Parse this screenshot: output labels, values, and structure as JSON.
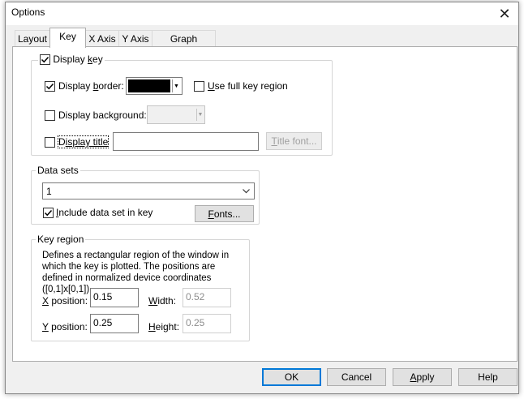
{
  "window": {
    "title": "Options"
  },
  "tabs": [
    {
      "label": "Layout",
      "active": false
    },
    {
      "label": "Key",
      "active": true
    },
    {
      "label": "X Axis",
      "active": false
    },
    {
      "label": "Y Axis",
      "active": false
    },
    {
      "label": "Graph Options",
      "active": false
    }
  ],
  "display_key": {
    "label_prefix": "Display ",
    "label_underline": "k",
    "label_suffix": "ey",
    "checked": true
  },
  "display_border": {
    "label_prefix": "Display ",
    "label_underline": "b",
    "label_suffix": "order:",
    "checked": true,
    "color": "#000000"
  },
  "use_full_key_region": {
    "label_underline": "U",
    "label_suffix": "se full key region",
    "checked": false
  },
  "display_background": {
    "label": "Display background:",
    "checked": false,
    "color": "#f0f0f0"
  },
  "display_title": {
    "label_prefix": "D",
    "label_underline": "isplay title",
    "label_suffix": "",
    "checked": false,
    "value": ""
  },
  "title_font_button": {
    "label_underline": "T",
    "label_suffix": "itle font..."
  },
  "data_sets": {
    "legend": "Data sets",
    "selected": "1",
    "include_label_prefix": "I",
    "include_label_suffix": "nclude data set in key",
    "include_checked": true,
    "fonts_underline": "F",
    "fonts_suffix": "onts..."
  },
  "key_region": {
    "legend": "Key region",
    "description": "Defines a rectangular region of the window in which the key is plotted. The positions are defined in normalized device coordinates ([0,1]x[0,1])",
    "x_label_underline": "X",
    "x_label_suffix": " position:",
    "x_value": "0.15",
    "y_label_underline": "Y",
    "y_label_suffix": " position:",
    "y_value": "0.25",
    "width_label_underline": "W",
    "width_label_suffix": "idth:",
    "width_value": "0.52",
    "height_label_underline": "H",
    "height_label_suffix": "eight:",
    "height_value": "0.25"
  },
  "buttons": {
    "ok": "OK",
    "cancel": "Cancel",
    "apply_underline": "A",
    "apply_suffix": "pply",
    "help": "Help"
  },
  "colors": {
    "accent": "#0078d7",
    "border_swatch": "#000000"
  }
}
